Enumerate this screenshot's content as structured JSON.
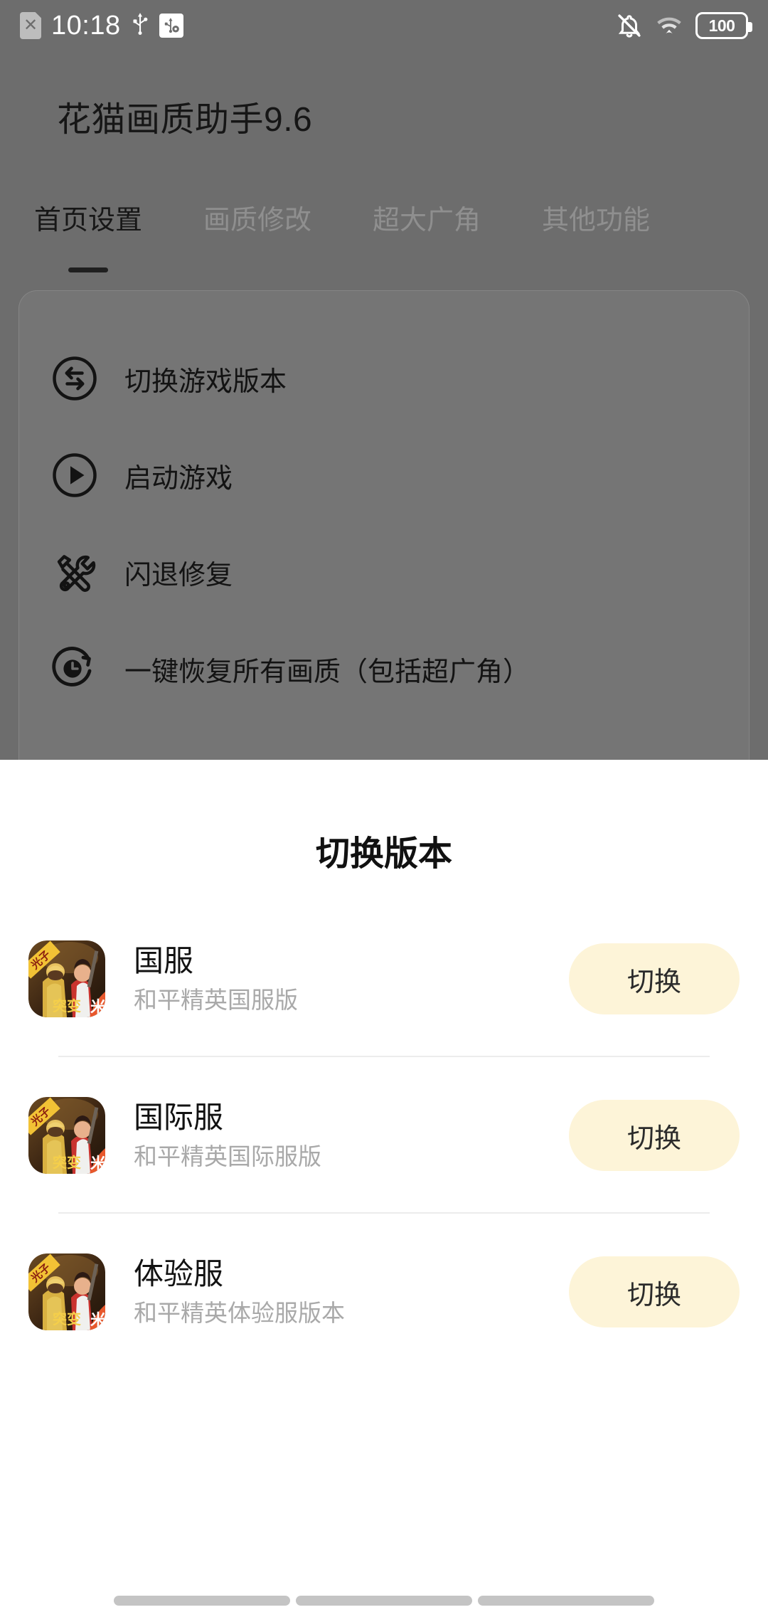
{
  "status_bar": {
    "time": "10:18",
    "sim_icon": "sim-card-off-icon",
    "usb_icon": "usb-icon",
    "usb_debug_icon": "usb-debugging-icon",
    "silent_icon": "bell-off-icon",
    "wifi_icon": "wifi-icon",
    "battery_level": "100"
  },
  "app": {
    "title": "花猫画质助手9.6",
    "tabs": [
      {
        "label": "首页设置",
        "active": true
      },
      {
        "label": "画质修改",
        "active": false
      },
      {
        "label": "超大广角",
        "active": false
      },
      {
        "label": "其他功能",
        "active": false
      }
    ],
    "menu_items": [
      {
        "label": "切换游戏版本",
        "icon": "swap-arrows-circle-icon"
      },
      {
        "label": "启动游戏",
        "icon": "play-circle-icon"
      },
      {
        "label": "闪退修复",
        "icon": "tools-wrench-screwdriver-icon"
      },
      {
        "label": "一键恢复所有画质（包括超广角）",
        "icon": "restore-clock-icon"
      }
    ]
  },
  "sheet": {
    "title": "切换版本",
    "rows": [
      {
        "icon": "game-app-icon",
        "title": "国服",
        "subtitle": "和平精英国服版",
        "button_label": "切换"
      },
      {
        "icon": "game-app-icon",
        "title": "国际服",
        "subtitle": "和平精英国际服版",
        "button_label": "切换"
      },
      {
        "icon": "game-app-icon",
        "title": "体验服",
        "subtitle": "和平精英体验服版本",
        "button_label": "切换"
      }
    ]
  },
  "nav_bar": {
    "pills": [
      "recents-pill",
      "home-pill",
      "back-pill"
    ]
  },
  "colors": {
    "overlay": "#6d6d6d",
    "sheet_bg": "#ffffff",
    "button_bg": "#fdf4d8",
    "text_primary": "#121212",
    "text_secondary": "#a9a9a9",
    "tab_inactive": "#8f8f8f",
    "divider": "#ececec"
  }
}
